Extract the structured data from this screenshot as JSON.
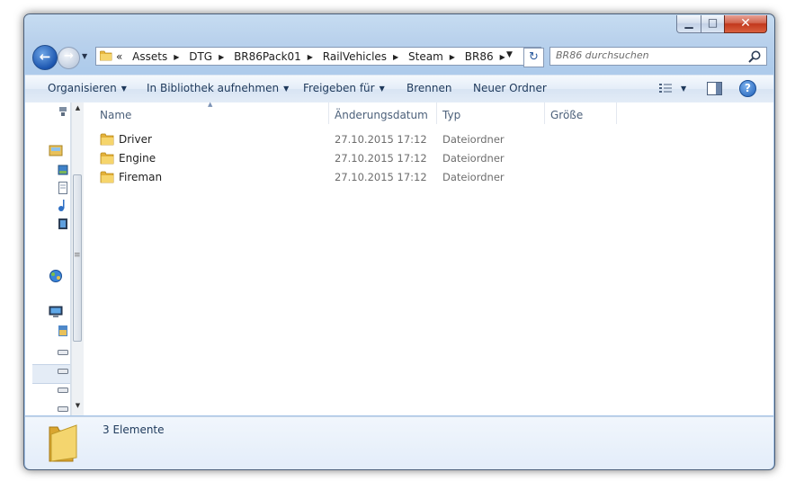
{
  "window": {
    "minimize_glyph": "▁",
    "maximize_glyph": "□",
    "close_glyph": "✕"
  },
  "nav": {
    "back_glyph": "←",
    "forward_glyph": "→",
    "recent_glyph": "▼"
  },
  "address": {
    "overflow": "«",
    "crumbs": [
      "Assets",
      "DTG",
      "BR86Pack01",
      "RailVehicles",
      "Steam",
      "BR86"
    ],
    "separator": "▶",
    "dropdown_glyph": "▼",
    "refresh_glyph": "↻"
  },
  "search": {
    "placeholder": "BR86 durchsuchen"
  },
  "toolbar": {
    "organize": "Organisieren",
    "library": "In Bibliothek aufnehmen",
    "share": "Freigeben für",
    "burn": "Brennen",
    "new_folder": "Neuer Ordner",
    "dropdown_glyph": "▼",
    "help_glyph": "?"
  },
  "columns": {
    "name": "Name",
    "date": "Änderungsdatum",
    "type": "Typ",
    "size": "Größe",
    "sort_glyph": "▲"
  },
  "files": [
    {
      "name": "Driver",
      "date": "27.10.2015 17:12",
      "type": "Dateiordner"
    },
    {
      "name": "Engine",
      "date": "27.10.2015 17:12",
      "type": "Dateiordner"
    },
    {
      "name": "Fireman",
      "date": "27.10.2015 17:12",
      "type": "Dateiordner"
    }
  ],
  "scrollbar": {
    "up_glyph": "▲",
    "down_glyph": "▼",
    "grip_glyph": "≡"
  },
  "status": {
    "count_text": "3 Elemente"
  },
  "colors": {
    "frame": "#a8c6e8",
    "toolbar_text": "#1e395b",
    "folder_yellow": "#f3cd5a",
    "close_red": "#c2371c"
  }
}
